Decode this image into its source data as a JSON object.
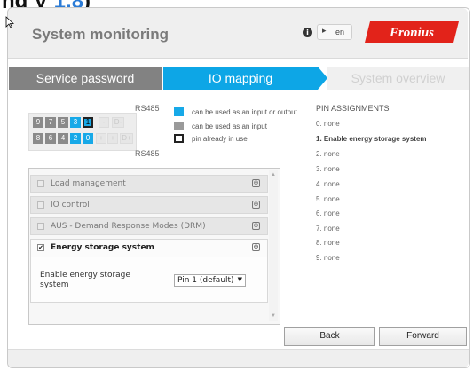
{
  "page": {
    "top_cut_text": "nd V",
    "top_cut_highlight": "1.8",
    "top_cut_tail": ")"
  },
  "header": {
    "title": "System monitoring",
    "info_icon": "info-icon",
    "lang_flag": "▸",
    "lang_code": "en",
    "logo_text": "Fronius",
    "logo_color": "#e2231a"
  },
  "steps": [
    {
      "label": "Service password"
    },
    {
      "label": "IO mapping"
    },
    {
      "label": "System overview"
    }
  ],
  "pins": {
    "rs485_top": "RS485",
    "rs485_bottom": "RS485",
    "row1": [
      "9",
      "7",
      "5",
      "3",
      "1",
      "-",
      "D-"
    ],
    "row2": [
      "8",
      "6",
      "4",
      "2",
      "0",
      "+",
      "+",
      "D+"
    ]
  },
  "legend": [
    {
      "text": "can be used as an input or output",
      "color": "#17a9e8"
    },
    {
      "text": "can be used as an input",
      "color": "#9a9a9a"
    },
    {
      "text": "pin already in use",
      "color": "#ffffff"
    }
  ],
  "pin_assignments": {
    "title": "PIN ASSIGNMENTS",
    "rows": [
      {
        "text": "0.  none"
      },
      {
        "text": "1.  Enable energy storage system"
      },
      {
        "text": "2.  none"
      },
      {
        "text": "3.  none"
      },
      {
        "text": "4.  none"
      },
      {
        "text": "5.  none"
      },
      {
        "text": "6.  none"
      },
      {
        "text": "7.  none"
      },
      {
        "text": "8.  none"
      },
      {
        "text": "9.  none"
      }
    ]
  },
  "accordion": [
    {
      "label": "Load management"
    },
    {
      "label": "IO control"
    },
    {
      "label": "AUS - Demand Response Modes (DRM)"
    },
    {
      "label": "Energy storage system"
    }
  ],
  "ess": {
    "field_label": "Enable energy storage system",
    "select_value": "Pin 1 (default)",
    "checked_mark": "✔",
    "expand_mark": "⊖"
  },
  "buttons": {
    "back": "Back",
    "forward": "Forward"
  }
}
